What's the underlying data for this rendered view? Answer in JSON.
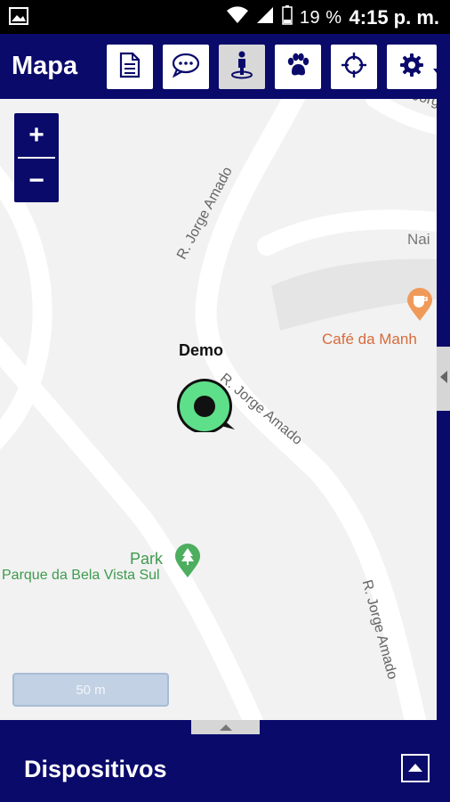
{
  "status_bar": {
    "battery_percent": "19 %",
    "time": "4:15 p. m."
  },
  "app_bar": {
    "title": "Mapa",
    "tools": [
      {
        "icon": "document-icon"
      },
      {
        "icon": "chat-icon"
      },
      {
        "icon": "person-location-icon",
        "active": true
      },
      {
        "icon": "paw-icon"
      },
      {
        "icon": "crosshair-icon"
      },
      {
        "icon": "gear-icon"
      }
    ]
  },
  "map": {
    "zoom_in": "+",
    "zoom_out": "−",
    "device_label": "Demo",
    "scale_label": "50 m",
    "streets": {
      "top_right": "R. Jorge",
      "upper": "R. Jorge Amado",
      "middle": "R. Jorge Amado",
      "lower": "R. Jorge Amado"
    },
    "pois": {
      "cafe": "Café da Manh",
      "nai": "Nai",
      "park_short": "Park",
      "park_full": "Parque da Bela Vista Sul"
    }
  },
  "bottom_panel": {
    "title": "Dispositivos"
  },
  "colors": {
    "brand_navy": "#0a0a6b",
    "marker_green": "#5ee08a",
    "poi_orange": "#d66b3c",
    "poi_green": "#3f9a4f"
  }
}
